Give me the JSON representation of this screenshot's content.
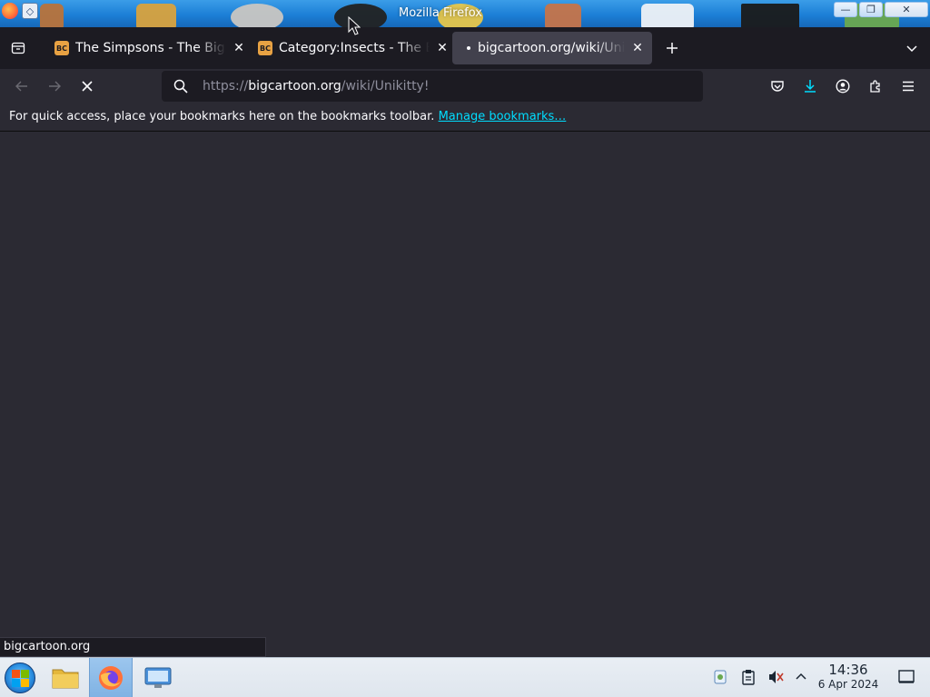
{
  "window": {
    "title": "Mozilla Firefox",
    "buttons": {
      "minimize": "—",
      "maximize": "❐",
      "close": "✕"
    }
  },
  "tabs": [
    {
      "label": "The Simpsons - The Big Cartoon Wiki",
      "favicon": "BC",
      "active": false
    },
    {
      "label": "Category:Insects - The Big Cartoon Wiki",
      "favicon": "BC",
      "active": false
    },
    {
      "label": "bigcartoon.org/wiki/Unikitty!",
      "favicon": "",
      "active": true
    }
  ],
  "toolbar": {
    "url_scheme": "https://",
    "url_host": "bigcartoon.org",
    "url_path": "/wiki/Unikitty!",
    "icons": [
      "back-icon",
      "forward-icon",
      "stop-icon",
      "search-icon",
      "pocket-icon",
      "download-icon",
      "account-icon",
      "extensions-icon",
      "menu-icon"
    ]
  },
  "bookmarks_bar": {
    "message": "For quick access, place your bookmarks here on the bookmarks toolbar.",
    "link": "Manage bookmarks…"
  },
  "status": {
    "text": "bigcartoon.org"
  },
  "taskbar": {
    "clock_time": "14:36",
    "clock_date": "6 Apr 2024",
    "apps": [
      "start-menu-icon",
      "file-manager-icon",
      "firefox-icon",
      "system-settings-icon"
    ]
  },
  "colors": {
    "accent": "#00ddff",
    "download_accent": "#00ddff",
    "tab_active_bg": "#42414d",
    "content_bg": "#2b2a33",
    "tabstrip_bg": "#1c1b22"
  }
}
